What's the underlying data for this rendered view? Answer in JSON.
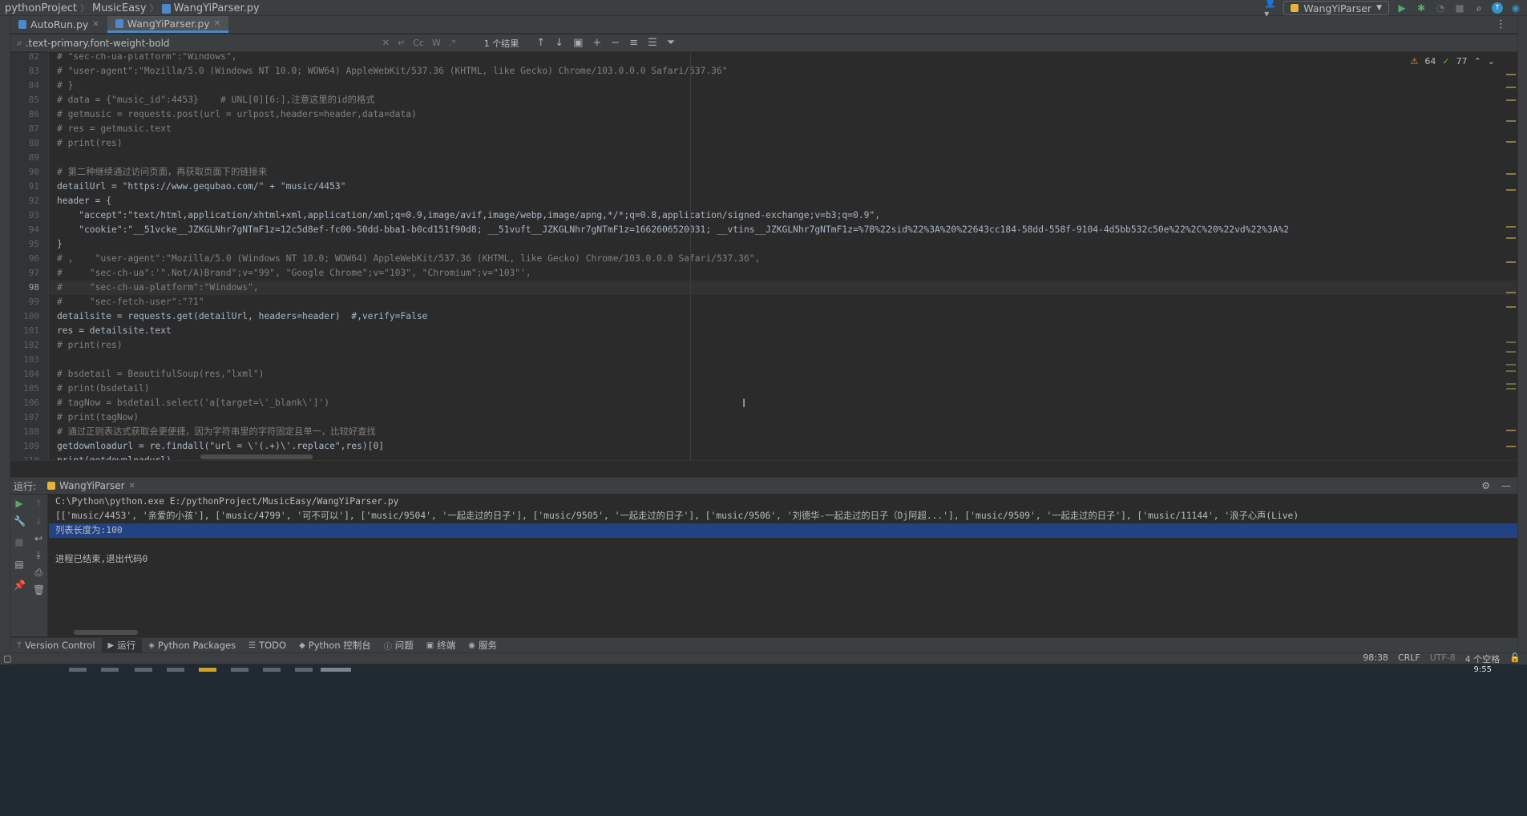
{
  "breadcrumb": [
    "pythonProject",
    "MusicEasy",
    "WangYiParser.py"
  ],
  "run_config": "WangYiParser",
  "tabs": [
    {
      "label": "AutoRun.py",
      "active": false
    },
    {
      "label": "WangYiParser.py",
      "active": true
    }
  ],
  "search": {
    "value": ".text-primary.font-weight-bold",
    "match_case": "Cc",
    "words": "W",
    "regex": ".*",
    "results": "1 个结果"
  },
  "inspections": {
    "warnings": "64",
    "weak_warnings": "77"
  },
  "editor": {
    "current_line": "98",
    "lines": [
      {
        "n": "82",
        "text": "# \"sec-ch-ua-platform\":\"Windows\","
      },
      {
        "n": "83",
        "text": "# \"user-agent\":\"Mozilla/5.0 (Windows NT 10.0; WOW64) AppleWebKit/537.36 (KHTML, like Gecko) Chrome/103.0.0.0 Safari/537.36\""
      },
      {
        "n": "84",
        "text": "# }"
      },
      {
        "n": "85",
        "text": "# data = {\"music_id\":4453}    # UNL[0][6:],注意这里的id的格式"
      },
      {
        "n": "86",
        "text": "# getmusic = requests.post(url = urlpost,headers=header,data=data)"
      },
      {
        "n": "87",
        "text": "# res = getmusic.text"
      },
      {
        "n": "88",
        "text": "# print(res)"
      },
      {
        "n": "89",
        "text": ""
      },
      {
        "n": "90",
        "text": "# 第二种继续通过访问页面，再获取页面下的链接来"
      },
      {
        "n": "91",
        "text": "detailUrl = \"https://www.gequbao.com/\" + \"music/4453\""
      },
      {
        "n": "92",
        "text": "header = {"
      },
      {
        "n": "93",
        "text": "    \"accept\":\"text/html,application/xhtml+xml,application/xml;q=0.9,image/avif,image/webp,image/apng,*/*;q=0.8,application/signed-exchange;v=b3;q=0.9\","
      },
      {
        "n": "94",
        "text": "    \"cookie\":\"__51vcke__JZKGLNhr7gNTmF1z=12c5d8ef-fc00-50dd-bba1-b0cd151f90d8; __51vuft__JZKGLNhr7gNTmF1z=1662606520031; __vtins__JZKGLNhr7gNTmF1z=%7B%22sid%22%3A%20%22643cc184-58dd-558f-9104-4d5bb532c50e%22%2C%20%22vd%22%3A%2"
      },
      {
        "n": "95",
        "text": "}"
      },
      {
        "n": "96",
        "text": "# ,    \"user-agent\":\"Mozilla/5.0 (Windows NT 10.0; WOW64) AppleWebKit/537.36 (KHTML, like Gecko) Chrome/103.0.0.0 Safari/537.36\","
      },
      {
        "n": "97",
        "text": "#     \"sec-ch-ua\":'\".Not/A)Brand\";v=\"99\", \"Google Chrome\";v=\"103\", \"Chromium\";v=\"103\"',"
      },
      {
        "n": "98",
        "text": "#     \"sec-ch-ua-platform\":\"Windows\","
      },
      {
        "n": "99",
        "text": "#     \"sec-fetch-user\":\"?1\""
      },
      {
        "n": "100",
        "text": "detailsite = requests.get(detailUrl, headers=header)  #,verify=False"
      },
      {
        "n": "101",
        "text": "res = detailsite.text"
      },
      {
        "n": "102",
        "text": "# print(res)"
      },
      {
        "n": "103",
        "text": ""
      },
      {
        "n": "104",
        "text": "# bsdetail = BeautifulSoup(res,\"lxml\")"
      },
      {
        "n": "105",
        "text": "# print(bsdetail)"
      },
      {
        "n": "106",
        "text": "# tagNow = bsdetail.select('a[target=\\'_blank\\']')"
      },
      {
        "n": "107",
        "text": "# print(tagNow)"
      },
      {
        "n": "108",
        "text": "# 通过正则表达式获取会更便捷，因为字符串里的字符固定且单一，比较好查找"
      },
      {
        "n": "109",
        "text": "getdownloadurl = re.findall(\"url = \\'(.+)\\'.replace\",res)[0]"
      },
      {
        "n": "110",
        "text": "print(getdownloadurl)"
      }
    ]
  },
  "run_panel": {
    "label": "运行:",
    "tab": "WangYiParser",
    "console": [
      "C:\\Python\\python.exe E:/pythonProject/MusicEasy/WangYiParser.py",
      "[['music/4453', '亲爱的小孩'], ['music/4799', '可不可以'], ['music/9504', '一起走过的日子'], ['music/9505', '一起走过的日子'], ['music/9506', '刘德华-一起走过的日子（Dj阿超...'], ['music/9509', '一起走过的日子'], ['music/11144', '浪子心声(Live)",
      "列表长度为:100",
      "",
      "进程已结束,退出代码0"
    ]
  },
  "bottom_tools": [
    {
      "label": "Version Control",
      "icon": "branch-icon"
    },
    {
      "label": "运行",
      "icon": "run-icon"
    },
    {
      "label": "Python Packages",
      "icon": "packages-icon"
    },
    {
      "label": "TODO",
      "icon": "list-icon"
    },
    {
      "label": "Python 控制台",
      "icon": "console-icon"
    },
    {
      "label": "问题",
      "icon": "info-icon"
    },
    {
      "label": "终端",
      "icon": "terminal-icon"
    },
    {
      "label": "服务",
      "icon": "services-icon"
    }
  ],
  "status": {
    "position": "98:38",
    "line_sep": "CRLF",
    "encoding": "UTF-8",
    "indent": "4 个空格"
  },
  "taskbar": {
    "clock": "9:55"
  },
  "colors": {
    "accent": "#4a88c7",
    "selection": "#214283",
    "comment": "#808080",
    "string": "#6a8759",
    "keyword": "#cc7832"
  }
}
